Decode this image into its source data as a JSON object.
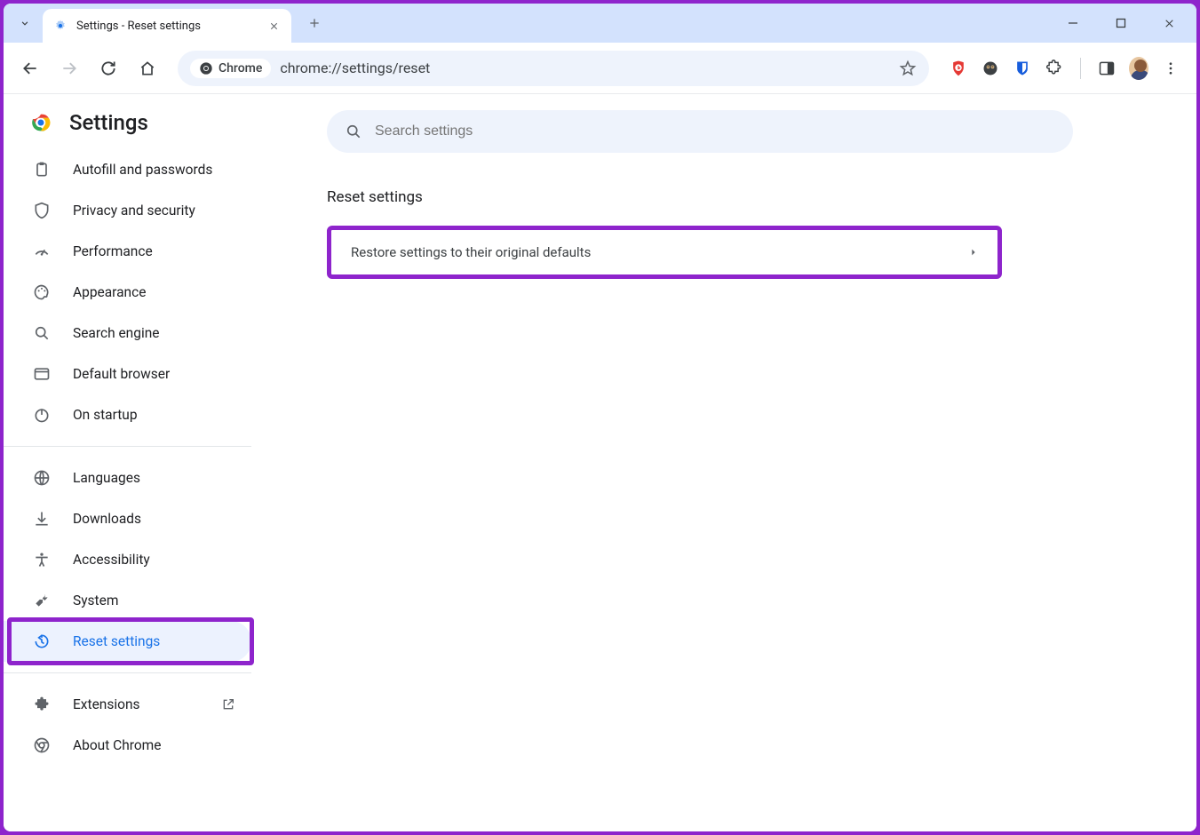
{
  "window": {
    "tab_title": "Settings - Reset settings"
  },
  "toolbar": {
    "chip_label": "Chrome",
    "url": "chrome://settings/reset"
  },
  "header": {
    "title": "Settings"
  },
  "search": {
    "placeholder": "Search settings"
  },
  "nav": {
    "autofill": "Autofill and passwords",
    "privacy": "Privacy and security",
    "performance": "Performance",
    "appearance": "Appearance",
    "search_engine": "Search engine",
    "default_browser": "Default browser",
    "on_startup": "On startup",
    "languages": "Languages",
    "downloads": "Downloads",
    "accessibility": "Accessibility",
    "system": "System",
    "reset": "Reset settings",
    "extensions": "Extensions",
    "about": "About Chrome"
  },
  "main": {
    "section_title": "Reset settings",
    "restore_row": "Restore settings to their original defaults"
  }
}
